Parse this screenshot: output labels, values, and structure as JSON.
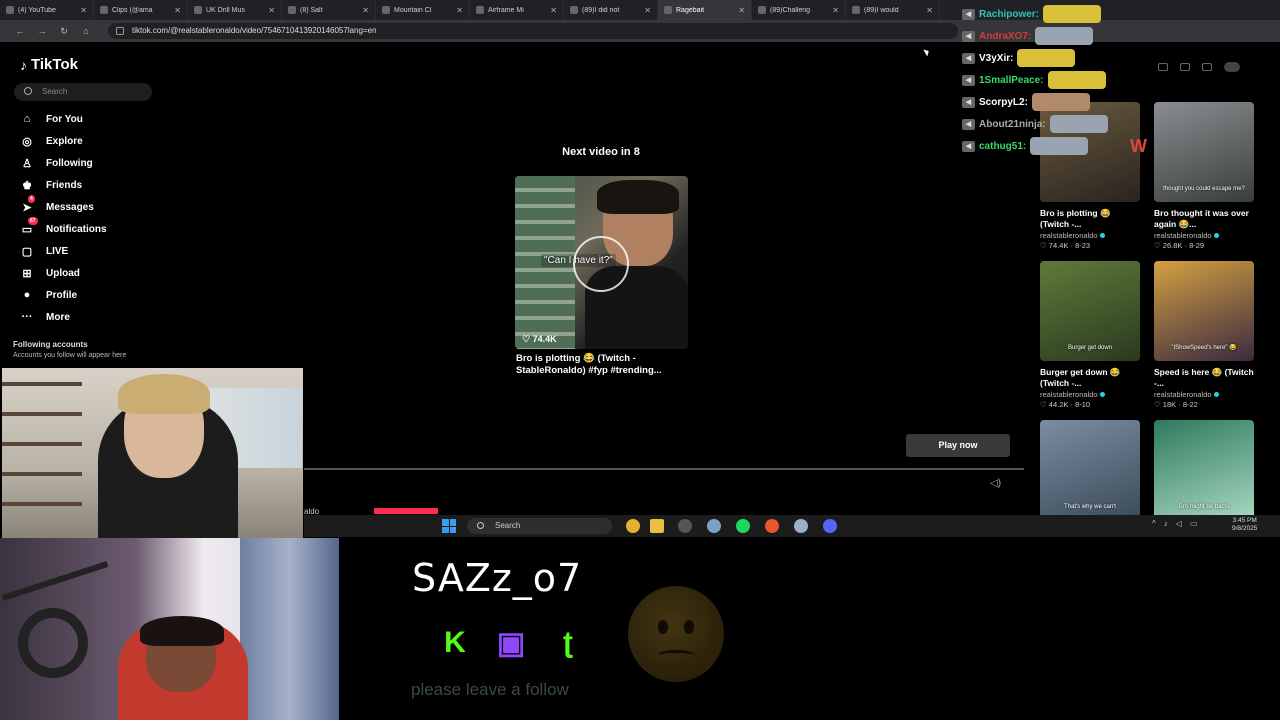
{
  "browser": {
    "tabs": [
      {
        "label": "(4) YouTube",
        "active": false
      },
      {
        "label": "Clips (@ama",
        "active": false
      },
      {
        "label": "UK Drill Mus",
        "active": false
      },
      {
        "label": "(8) Salt",
        "active": false
      },
      {
        "label": "Mountain Cl",
        "active": false
      },
      {
        "label": "Airframe Mi",
        "active": false
      },
      {
        "label": "(89)I did not",
        "active": false
      },
      {
        "label": "Ragebait",
        "active": true
      },
      {
        "label": "(89)Challeng",
        "active": false
      },
      {
        "label": "(89)I would",
        "active": false
      }
    ],
    "url": "tiktok.com/@realstableronaldo/video/7546710413920146057lang=en"
  },
  "tiktok": {
    "brand": "TikTok",
    "search_placeholder": "Search",
    "nav": [
      {
        "label": "For You",
        "icon": "home-icon",
        "glyph": "⌂"
      },
      {
        "label": "Explore",
        "icon": "compass-icon",
        "glyph": "◎"
      },
      {
        "label": "Following",
        "icon": "following-icon",
        "glyph": "♙"
      },
      {
        "label": "Friends",
        "icon": "friends-icon",
        "glyph": "♚"
      },
      {
        "label": "Messages",
        "icon": "messages-icon",
        "glyph": "➤",
        "badge": "4"
      },
      {
        "label": "Notifications",
        "icon": "bell-icon",
        "glyph": "▭",
        "badge": "67"
      },
      {
        "label": "LIVE",
        "icon": "live-icon",
        "glyph": "▢"
      },
      {
        "label": "Upload",
        "icon": "upload-icon",
        "glyph": "⊞"
      },
      {
        "label": "Profile",
        "icon": "profile-avatar-icon",
        "glyph": "●"
      },
      {
        "label": "More",
        "icon": "more-icon",
        "glyph": "···"
      }
    ],
    "following_title": "Following accounts",
    "following_sub": "Accounts you follow will appear here",
    "next_label": "Next video in 8",
    "next_video": {
      "caption_overlay": "\"Can I have it?\"",
      "likes": "74.4K",
      "title": "Bro is plotting 😂 (Twitch - StableRonaldo) #fyp #trending..."
    },
    "play_now": "Play now",
    "author_peek": "aldo",
    "related": [
      {
        "title": "Bro is plotting 😂 (Twitch -...",
        "author": "realstableronaldo",
        "stats": "♡ 74.4K · 8-23",
        "overlay": "",
        "c1": "#6a5a3e",
        "c2": "#2a2420"
      },
      {
        "title": "Bro thought it was over again 😂...",
        "author": "realstableronaldo",
        "stats": "♡ 26.8K · 8-29",
        "overlay": "thought you could escape me?",
        "c1": "#8a8e92",
        "c2": "#3a3e3a"
      },
      {
        "title": "Burger get down 😂 (Twitch -...",
        "author": "realstableronaldo",
        "stats": "♡ 44.2K · 8-10",
        "overlay": "Burger get down",
        "c1": "#5e7a3a",
        "c2": "#2a3a1e"
      },
      {
        "title": "Speed is here 😂 (Twitch -...",
        "author": "realstableronaldo",
        "stats": "♡ 18K · 8-22",
        "overlay": "\"IShowSpeed's here\" 😂",
        "c1": "#d4a040",
        "c2": "#3a2a40"
      },
      {
        "title": "",
        "author": "",
        "stats": "",
        "overlay": "That's why we can't",
        "c1": "#7a8ea0",
        "c2": "#3a4a5a"
      },
      {
        "title": "",
        "author": "",
        "stats": "",
        "overlay": "Bro might be Itachi",
        "c1": "#2e7a5e",
        "c2": "#a8d8c0"
      }
    ]
  },
  "chat": {
    "rows": [
      {
        "user": "Rachipower:",
        "color": "#34c1ba",
        "emote": "#d8c038"
      },
      {
        "user": "AndraXO7:",
        "color": "#d83a3a",
        "emote": "#9aa4b0"
      },
      {
        "user": "V3yXir:",
        "color": "#ffffff",
        "emote": "#d8c038"
      },
      {
        "user": "1SmallPeace:",
        "color": "#3ad86a",
        "emote": "#d8c038"
      },
      {
        "user": "ScorpyL2:",
        "color": "#ffffff",
        "emote": "#b08a6a"
      },
      {
        "user": "About21ninja:",
        "color": "#aaaaaa",
        "emote": "#9aa4b0"
      },
      {
        "user": "cathug51:",
        "color": "#3ad86a",
        "emote": "#9aa4b0"
      }
    ],
    "w_letter": "W"
  },
  "taskbar": {
    "search": "Search",
    "time": "3:45 PM",
    "date": "9/8/2025"
  },
  "overlay": {
    "streamer": "SAZz_o7",
    "socials": [
      {
        "icon": "kick-icon",
        "glyph": "K",
        "color": "#53fc18"
      },
      {
        "icon": "twitch-icon",
        "glyph": "▣",
        "color": "#9146ff"
      },
      {
        "icon": "tiktok-social-icon",
        "glyph": "ʈ",
        "color": "#53fc18"
      }
    ],
    "follow_msg": "please leave a follow"
  }
}
